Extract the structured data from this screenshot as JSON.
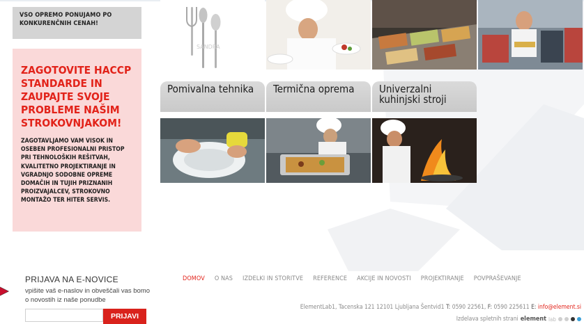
{
  "promo_grey": {
    "line1": "VSO OPREMO PONUJAMO PO",
    "line2": "KONKURENČNIH CENAH!"
  },
  "promo_pink": {
    "headline": [
      "ZAGOTOVITE HACCP",
      "STANDARDE IN",
      "ZAUPAJTE SVOJE",
      "PROBLEME NAŠIM",
      "STROKOVNJAKOM!"
    ],
    "body": [
      "ZAGOTAVLJAMO VAM VISOK IN",
      "OSEBEN PROFESIONALNI PRISTOP",
      "PRI TEHNOLOŠKIH REŠITVAH,",
      "KVALITETNO PROJEKTIRANJE IN",
      "VGRADNJO SODOBNE OPREME",
      "DOMAČIH IN TUJIH PRIZNANIH",
      "PROIZVAJALCEV, STROKOVNO",
      "MONTAŽO TER HITER SERVIS."
    ]
  },
  "categories": {
    "c1": "Pomivalna tehnika",
    "c2": "Termična oprema",
    "c3_line1": "Univerzalni",
    "c3_line2": "kuhinjski stroji"
  },
  "images": {
    "cutlery_watermark": "SANDRA"
  },
  "newsletter": {
    "title": "PRIJAVA NA E-NOVICE",
    "description": "vpišite vaš e-naslov in obveščali vas bomo o novostih iz naše ponudbe",
    "input_value": "",
    "button": "PRIJAVI"
  },
  "nav": {
    "items": [
      "DOMOV",
      "O NAS",
      "IZDELKI IN STORITVE",
      "REFERENCE",
      "AKCIJE IN NOVOSTI",
      "PROJEKTIRANJE",
      "POVPRAŠEVANJE"
    ]
  },
  "footer": {
    "address": "ElementLab1, Tacenska 121 12101 Ljubljana Šentvid1",
    "t_label": "T:",
    "t_value": "0590 22561,",
    "f_label": "F:",
    "f_value": "0590 225611",
    "e_label": "E:",
    "email": "info@element.si",
    "credit": "Izdelava spletnih strani",
    "logo": "element",
    "logo_sub": "lab"
  },
  "colors": {
    "accent_red": "#e2231a",
    "pink_box": "#fad9d9",
    "grey_box": "#d4d4d4",
    "nav_text": "#8a8a8a"
  }
}
